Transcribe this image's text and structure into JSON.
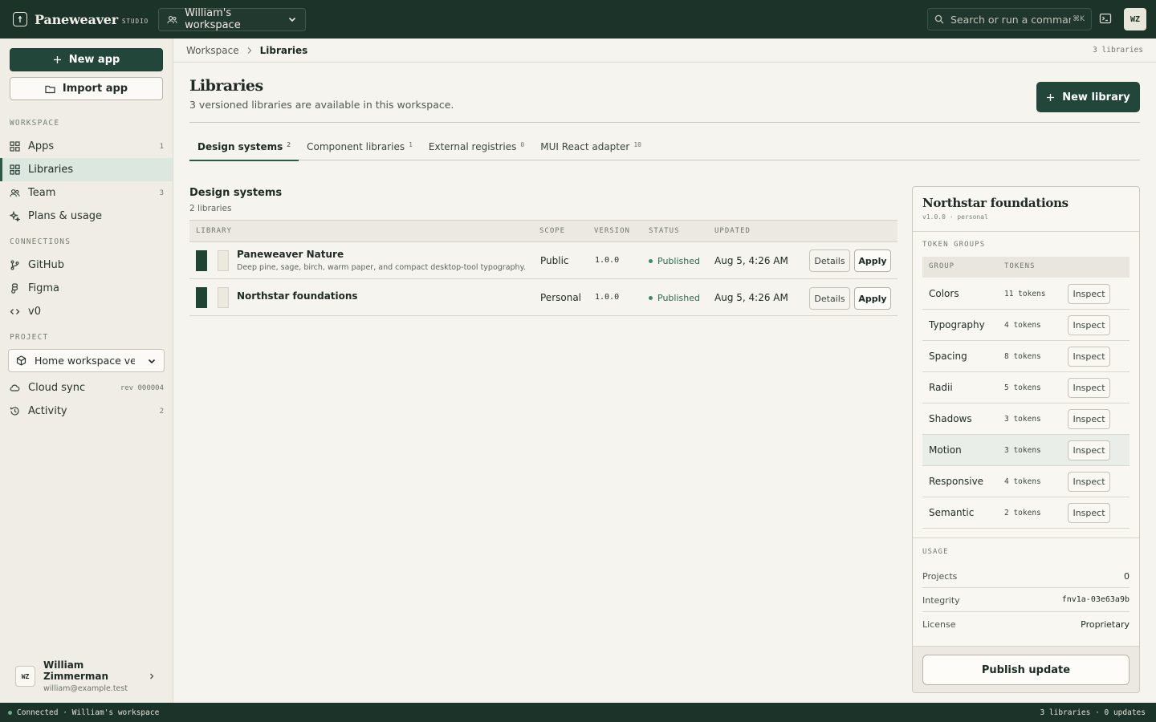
{
  "topbar": {
    "brand": "Paneweaver",
    "brand_suffix": "STUDIO",
    "workspace": "William's workspace",
    "search_placeholder": "Search or run a command",
    "search_shortcut": "⌘K",
    "avatar_initials": "WZ"
  },
  "sidebar": {
    "new_app": "New app",
    "import_app": "Import app",
    "workspace_label": "WORKSPACE",
    "workspace_items": [
      {
        "label": "Apps",
        "count": "1",
        "icon": "grid-icon"
      },
      {
        "label": "Libraries",
        "count": "",
        "icon": "grid-icon",
        "active": true
      },
      {
        "label": "Team",
        "count": "3",
        "icon": "users-icon"
      },
      {
        "label": "Plans & usage",
        "count": "",
        "icon": "sparkle-icon"
      }
    ],
    "connections_label": "CONNECTIONS",
    "connection_items": [
      {
        "label": "GitHub",
        "icon": "branch-icon"
      },
      {
        "label": "Figma",
        "icon": "figma-icon"
      },
      {
        "label": "v0",
        "icon": "code-icon"
      }
    ],
    "project_label": "PROJECT",
    "project_select": "Home workspace version",
    "project_items": [
      {
        "label": "Cloud sync",
        "count": "rev 000004",
        "icon": "cloud-icon"
      },
      {
        "label": "Activity",
        "count": "2",
        "icon": "history-icon"
      }
    ],
    "user": {
      "initials": "WZ",
      "name": "William Zimmerman",
      "email": "william@example.test"
    }
  },
  "breadcrumb": {
    "items": [
      "Workspace",
      "Libraries"
    ],
    "meta": "3 libraries"
  },
  "page": {
    "title": "Libraries",
    "subtitle": "3 versioned libraries are available in this workspace.",
    "new_library": "New library"
  },
  "tabs": [
    {
      "label": "Design systems",
      "count": "2",
      "active": true
    },
    {
      "label": "Component libraries",
      "count": "1"
    },
    {
      "label": "External registries",
      "count": "0"
    },
    {
      "label": "MUI React adapter",
      "count": "10"
    }
  ],
  "section": {
    "title": "Design systems",
    "subtitle": "2 libraries"
  },
  "table": {
    "headers": [
      "LIBRARY",
      "SCOPE",
      "VERSION",
      "STATUS",
      "UPDATED"
    ],
    "rows": [
      {
        "name": "Paneweaver Nature",
        "description": "Deep pine, sage, birch, warm paper, and compact desktop-tool typography.",
        "scope": "Public",
        "version": "1.0.0",
        "status": "Published",
        "updated": "Aug 5, 4:26 AM",
        "details": "Details",
        "apply": "Apply",
        "swatches": [
          "#1f4434",
          "#ece9df"
        ]
      },
      {
        "name": "Northstar foundations",
        "description": "",
        "scope": "Personal",
        "version": "1.0.0",
        "status": "Published",
        "updated": "Aug 5, 4:26 AM",
        "details": "Details",
        "apply": "Apply",
        "swatches": [
          "#1f4434",
          "#ece9df"
        ]
      }
    ]
  },
  "panel": {
    "title": "Northstar foundations",
    "meta": "v1.0.0 · personal",
    "token_groups_label": "TOKEN GROUPS",
    "headers": [
      "GROUP",
      "TOKENS"
    ],
    "inspect_label": "Inspect",
    "groups": [
      {
        "name": "Colors",
        "tokens": "11 tokens"
      },
      {
        "name": "Typography",
        "tokens": "4 tokens"
      },
      {
        "name": "Spacing",
        "tokens": "8 tokens"
      },
      {
        "name": "Radii",
        "tokens": "5 tokens"
      },
      {
        "name": "Shadows",
        "tokens": "3 tokens"
      },
      {
        "name": "Motion",
        "tokens": "3 tokens"
      },
      {
        "name": "Responsive",
        "tokens": "4 tokens"
      },
      {
        "name": "Semantic",
        "tokens": "2 tokens"
      }
    ],
    "usage_label": "USAGE",
    "usage": [
      {
        "key": "Projects",
        "value": "0"
      },
      {
        "key": "Integrity",
        "value": "fnv1a-03e63a9b"
      },
      {
        "key": "License",
        "value": "Proprietary"
      }
    ],
    "publish": "Publish update"
  },
  "statusbar": {
    "left": "Connected · William's workspace",
    "right": "3 libraries · 0 updates"
  },
  "colors": {
    "topbar": "#1b3329",
    "accent": "#22473a",
    "published": "#3f8a66"
  }
}
